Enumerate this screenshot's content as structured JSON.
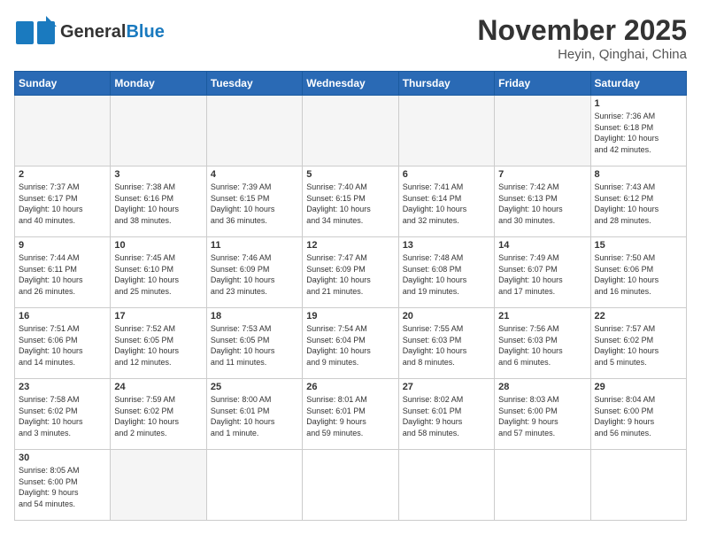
{
  "header": {
    "logo_general": "General",
    "logo_blue": "Blue",
    "month_title": "November 2025",
    "location": "Heyin, Qinghai, China"
  },
  "weekdays": [
    "Sunday",
    "Monday",
    "Tuesday",
    "Wednesday",
    "Thursday",
    "Friday",
    "Saturday"
  ],
  "days": [
    {
      "num": "",
      "info": ""
    },
    {
      "num": "",
      "info": ""
    },
    {
      "num": "",
      "info": ""
    },
    {
      "num": "",
      "info": ""
    },
    {
      "num": "",
      "info": ""
    },
    {
      "num": "",
      "info": ""
    },
    {
      "num": "1",
      "info": "Sunrise: 7:36 AM\nSunset: 6:18 PM\nDaylight: 10 hours\nand 42 minutes."
    },
    {
      "num": "2",
      "info": "Sunrise: 7:37 AM\nSunset: 6:17 PM\nDaylight: 10 hours\nand 40 minutes."
    },
    {
      "num": "3",
      "info": "Sunrise: 7:38 AM\nSunset: 6:16 PM\nDaylight: 10 hours\nand 38 minutes."
    },
    {
      "num": "4",
      "info": "Sunrise: 7:39 AM\nSunset: 6:15 PM\nDaylight: 10 hours\nand 36 minutes."
    },
    {
      "num": "5",
      "info": "Sunrise: 7:40 AM\nSunset: 6:15 PM\nDaylight: 10 hours\nand 34 minutes."
    },
    {
      "num": "6",
      "info": "Sunrise: 7:41 AM\nSunset: 6:14 PM\nDaylight: 10 hours\nand 32 minutes."
    },
    {
      "num": "7",
      "info": "Sunrise: 7:42 AM\nSunset: 6:13 PM\nDaylight: 10 hours\nand 30 minutes."
    },
    {
      "num": "8",
      "info": "Sunrise: 7:43 AM\nSunset: 6:12 PM\nDaylight: 10 hours\nand 28 minutes."
    },
    {
      "num": "9",
      "info": "Sunrise: 7:44 AM\nSunset: 6:11 PM\nDaylight: 10 hours\nand 26 minutes."
    },
    {
      "num": "10",
      "info": "Sunrise: 7:45 AM\nSunset: 6:10 PM\nDaylight: 10 hours\nand 25 minutes."
    },
    {
      "num": "11",
      "info": "Sunrise: 7:46 AM\nSunset: 6:09 PM\nDaylight: 10 hours\nand 23 minutes."
    },
    {
      "num": "12",
      "info": "Sunrise: 7:47 AM\nSunset: 6:09 PM\nDaylight: 10 hours\nand 21 minutes."
    },
    {
      "num": "13",
      "info": "Sunrise: 7:48 AM\nSunset: 6:08 PM\nDaylight: 10 hours\nand 19 minutes."
    },
    {
      "num": "14",
      "info": "Sunrise: 7:49 AM\nSunset: 6:07 PM\nDaylight: 10 hours\nand 17 minutes."
    },
    {
      "num": "15",
      "info": "Sunrise: 7:50 AM\nSunset: 6:06 PM\nDaylight: 10 hours\nand 16 minutes."
    },
    {
      "num": "16",
      "info": "Sunrise: 7:51 AM\nSunset: 6:06 PM\nDaylight: 10 hours\nand 14 minutes."
    },
    {
      "num": "17",
      "info": "Sunrise: 7:52 AM\nSunset: 6:05 PM\nDaylight: 10 hours\nand 12 minutes."
    },
    {
      "num": "18",
      "info": "Sunrise: 7:53 AM\nSunset: 6:05 PM\nDaylight: 10 hours\nand 11 minutes."
    },
    {
      "num": "19",
      "info": "Sunrise: 7:54 AM\nSunset: 6:04 PM\nDaylight: 10 hours\nand 9 minutes."
    },
    {
      "num": "20",
      "info": "Sunrise: 7:55 AM\nSunset: 6:03 PM\nDaylight: 10 hours\nand 8 minutes."
    },
    {
      "num": "21",
      "info": "Sunrise: 7:56 AM\nSunset: 6:03 PM\nDaylight: 10 hours\nand 6 minutes."
    },
    {
      "num": "22",
      "info": "Sunrise: 7:57 AM\nSunset: 6:02 PM\nDaylight: 10 hours\nand 5 minutes."
    },
    {
      "num": "23",
      "info": "Sunrise: 7:58 AM\nSunset: 6:02 PM\nDaylight: 10 hours\nand 3 minutes."
    },
    {
      "num": "24",
      "info": "Sunrise: 7:59 AM\nSunset: 6:02 PM\nDaylight: 10 hours\nand 2 minutes."
    },
    {
      "num": "25",
      "info": "Sunrise: 8:00 AM\nSunset: 6:01 PM\nDaylight: 10 hours\nand 1 minute."
    },
    {
      "num": "26",
      "info": "Sunrise: 8:01 AM\nSunset: 6:01 PM\nDaylight: 9 hours\nand 59 minutes."
    },
    {
      "num": "27",
      "info": "Sunrise: 8:02 AM\nSunset: 6:01 PM\nDaylight: 9 hours\nand 58 minutes."
    },
    {
      "num": "28",
      "info": "Sunrise: 8:03 AM\nSunset: 6:00 PM\nDaylight: 9 hours\nand 57 minutes."
    },
    {
      "num": "29",
      "info": "Sunrise: 8:04 AM\nSunset: 6:00 PM\nDaylight: 9 hours\nand 56 minutes."
    },
    {
      "num": "30",
      "info": "Sunrise: 8:05 AM\nSunset: 6:00 PM\nDaylight: 9 hours\nand 54 minutes."
    },
    {
      "num": "",
      "info": ""
    }
  ]
}
